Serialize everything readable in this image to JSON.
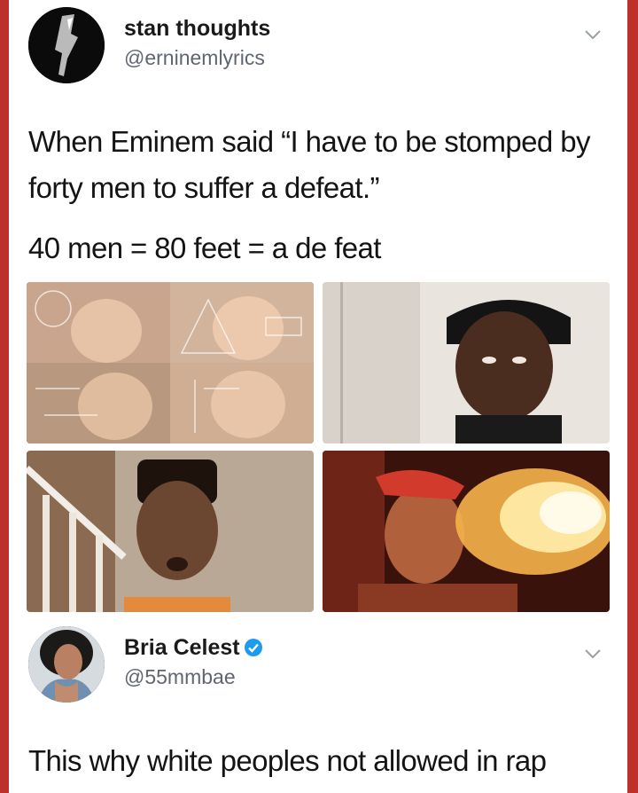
{
  "tweet": {
    "user_name": "stan thoughts",
    "user_handle": "@erninemlyrics",
    "text_line1": "When Eminem said “I have to be stomped by forty men to suffer a defeat.”",
    "text_line2": "40 men = 80 feet = a de feat",
    "media": [
      {
        "description": "confused-math-lady-meme"
      },
      {
        "description": "man-in-durag-thinking"
      },
      {
        "description": "shocked-young-man"
      },
      {
        "description": "man-breathing-fire"
      }
    ]
  },
  "reply": {
    "user_name": "Bria Celest",
    "user_handle": "@55mmbae",
    "text": "This why white peoples not allowed in rap",
    "verified": true
  },
  "colors": {
    "border": "#c0302a",
    "verified": "#1d9bf0",
    "handle": "#5f6670"
  },
  "icons": {
    "menu": "chevron-down-icon",
    "verified": "verified-badge-icon"
  }
}
